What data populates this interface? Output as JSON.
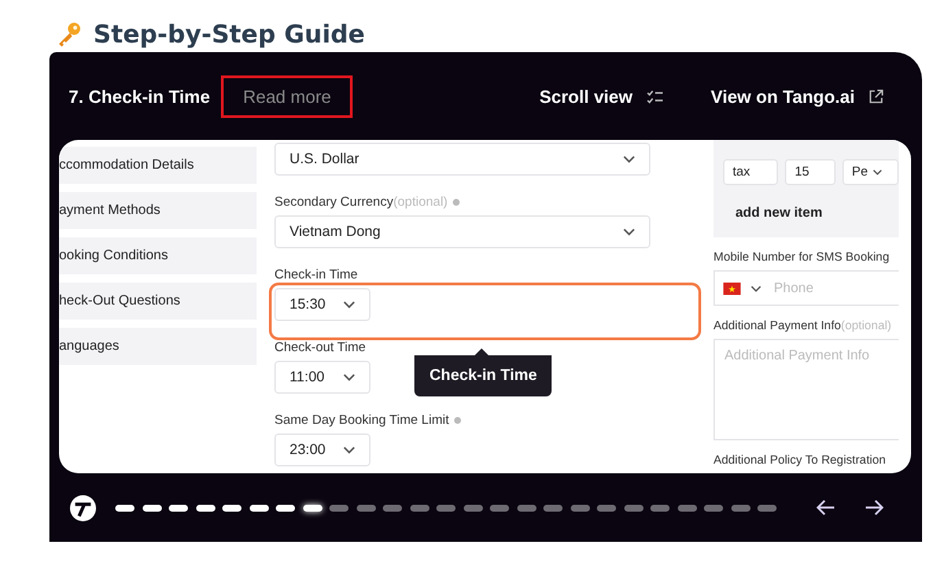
{
  "heading": {
    "text": "Step-by-Step Guide"
  },
  "player": {
    "step_title": "7. Check-in Time",
    "read_more": {
      "label": "Read more",
      "highlighted": true
    },
    "scroll_view": "Scroll view",
    "view_link": "View on Tango.ai",
    "screenshot": {
      "nav_items": [
        {
          "label": "ccommodation Details"
        },
        {
          "label": "ayment Methods"
        },
        {
          "label": "ooking Conditions"
        },
        {
          "label": "heck-Out Questions"
        },
        {
          "label": "anguages"
        }
      ],
      "form_fields": [
        {
          "kind": "wide",
          "value": "U.S. Dollar",
          "highlighted": false
        },
        {
          "kind": "wide",
          "label": "Secondary Currency",
          "optional": "(optional)",
          "info": true,
          "value": "Vietnam Dong",
          "highlighted": false
        },
        {
          "kind": "small",
          "label": "Check-in Time",
          "info": false,
          "value": "15:30",
          "highlighted": true
        },
        {
          "kind": "small",
          "label": "Check-out Time",
          "info": false,
          "value": "11:00",
          "highlighted": false
        },
        {
          "kind": "small",
          "label": "Same Day Booking Time Limit",
          "info": true,
          "value": "23:00",
          "highlighted": false
        }
      ],
      "fee_row": {
        "label_value": "tax",
        "fee_value": "15",
        "unit": "Pe",
        "add_item": "add new item"
      },
      "phone": {
        "label": "Mobile Number for SMS Booking",
        "placeholder": "Phone"
      },
      "payment_info": {
        "label": "Additional Payment Info",
        "optional": "(optional)",
        "placeholder": "Additional Payment Info"
      },
      "policy_label": "Additional Policy To Registration",
      "tooltip": "Check-in Time"
    },
    "progress": [
      {
        "done": true,
        "selected": false
      },
      {
        "done": true,
        "selected": false
      },
      {
        "done": true,
        "selected": false
      },
      {
        "done": true,
        "selected": false
      },
      {
        "done": true,
        "selected": false
      },
      {
        "done": true,
        "selected": false
      },
      {
        "done": true,
        "selected": false
      },
      {
        "done": true,
        "selected": true
      },
      {
        "done": false,
        "selected": false
      },
      {
        "done": false,
        "selected": false
      },
      {
        "done": false,
        "selected": false
      },
      {
        "done": false,
        "selected": false
      },
      {
        "done": false,
        "selected": false
      },
      {
        "done": false,
        "selected": false
      },
      {
        "done": false,
        "selected": false
      },
      {
        "done": false,
        "selected": false
      },
      {
        "done": false,
        "selected": false
      },
      {
        "done": false,
        "selected": false
      },
      {
        "done": false,
        "selected": false
      },
      {
        "done": false,
        "selected": false
      },
      {
        "done": false,
        "selected": false
      },
      {
        "done": false,
        "selected": false
      },
      {
        "done": false,
        "selected": false
      },
      {
        "done": false,
        "selected": false
      },
      {
        "done": false,
        "selected": false
      }
    ]
  }
}
